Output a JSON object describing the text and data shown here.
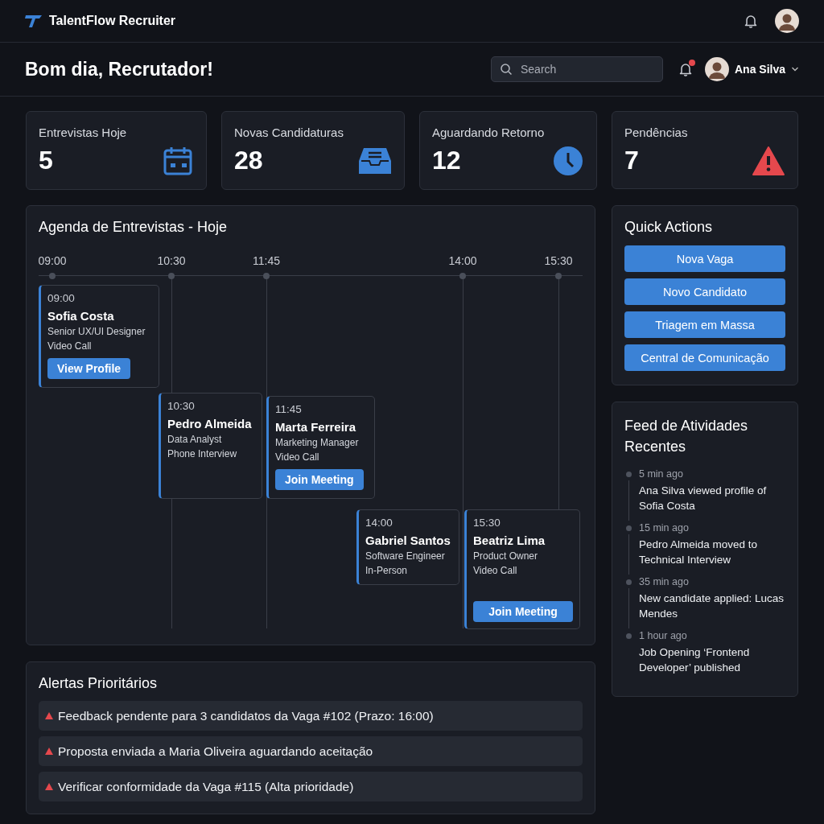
{
  "app": {
    "name": "TalentFlow Recruiter"
  },
  "header": {
    "greeting": "Bom dia, Recrutador!",
    "search": {
      "placeholder": "Search"
    },
    "notifications": {
      "unread": true
    },
    "user": {
      "name": "Ana Silva"
    }
  },
  "stats": [
    {
      "label": "Entrevistas Hoje",
      "value": "5"
    },
    {
      "label": "Novas Candidaturas",
      "value": "28"
    },
    {
      "label": "Aguardando Retorno",
      "value": "12"
    },
    {
      "label": "Pendências",
      "value": "7"
    }
  ],
  "agenda": {
    "title": "Agenda de Entrevistas - Hoje",
    "ticks": [
      "09:00",
      "10:30",
      "11:45",
      "14:00",
      "15:30"
    ],
    "interviews": [
      {
        "time": "09:00",
        "name": "Sofia Costa",
        "role": "Senior UX/UI Designer",
        "mode": "Video Call",
        "button": "View Profile"
      },
      {
        "time": "10:30",
        "name": "Pedro Almeida",
        "role": "Data Analyst",
        "mode": "Phone Interview"
      },
      {
        "time": "11:45",
        "name": "Marta Ferreira",
        "role": "Marketing Manager",
        "mode": "Video Call",
        "button": "Join Meeting"
      },
      {
        "time": "14:00",
        "name": "Gabriel Santos",
        "role": "Software Engineer",
        "mode": "In-Person"
      },
      {
        "time": "15:30",
        "name": "Beatriz Lima",
        "role": "Product Owner",
        "mode": "Video Call",
        "button": "Join Meeting"
      }
    ]
  },
  "quick_actions": {
    "title": "Quick Actions",
    "buttons": [
      "Nova Vaga",
      "Novo Candidato",
      "Triagem em Massa",
      "Central de Comunicação"
    ]
  },
  "feed": {
    "title": "Feed de Atividades Recentes",
    "items": [
      {
        "time": "5 min ago",
        "text": "Ana Silva viewed profile of Sofia Costa"
      },
      {
        "time": "15 min ago",
        "text": "Pedro Almeida moved to Technical Interview"
      },
      {
        "time": "35 min ago",
        "text": "New candidate applied: Lucas Mendes"
      },
      {
        "time": "1 hour ago",
        "text": "Job Opening ‘Frontend Developer’ published"
      }
    ]
  },
  "alerts": {
    "title": "Alertas Prioritários",
    "items": [
      "Feedback pendente para 3 candidatos da Vaga #102 (Prazo: 16:00)",
      "Proposta enviada a Maria Oliveira aguardando aceitação",
      "Verificar conformidade da Vaga #115 (Alta prioridade)"
    ]
  }
}
